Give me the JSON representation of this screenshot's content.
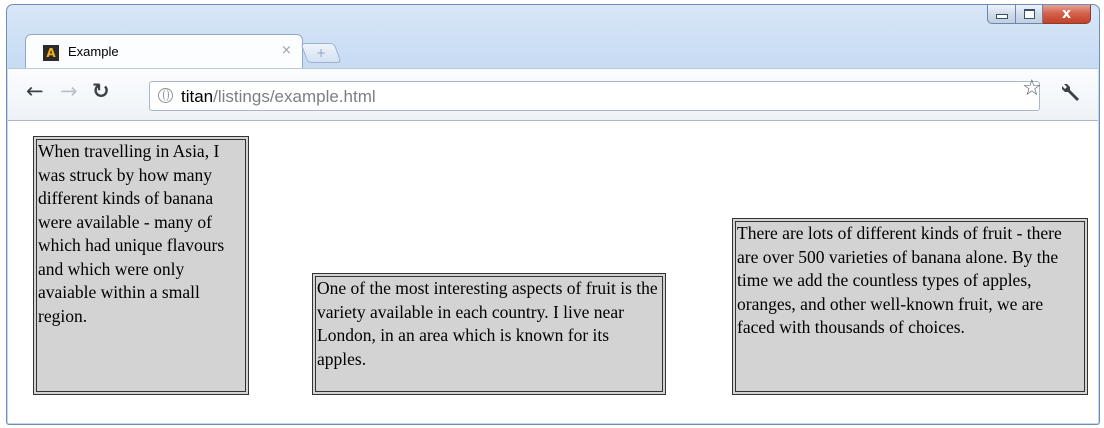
{
  "browser": {
    "tab": {
      "title": "Example",
      "close_glyph": "×",
      "favicon": "A"
    },
    "new_tab_glyph": "+",
    "address": {
      "host": "titan",
      "path": "/listings/example.html"
    },
    "window_controls": {
      "close_glyph": "x"
    },
    "icons": [
      "back-arrow-icon",
      "forward-arrow-icon",
      "reload-icon",
      "globe-icon",
      "star-icon",
      "wrench-icon"
    ]
  },
  "page": {
    "paragraphs": [
      "When travelling in Asia, I was struck by how many different kinds of banana were available - many of which had unique flavours and which were only avaiable within a small region.",
      "One of the most interesting aspects of fruit is the variety available in each country. I live near London, in an area which is known for its apples.",
      "There are lots of different kinds of fruit - there are over 500 varieties of banana alone. By the time we add the countless types of apples, oranges, and other well-known fruit, we are faced with thousands of choices."
    ]
  },
  "colors": {
    "paragraph_background": "#d3d3d3",
    "paragraph_border": "#333333",
    "frame": "#c7dbf3"
  }
}
